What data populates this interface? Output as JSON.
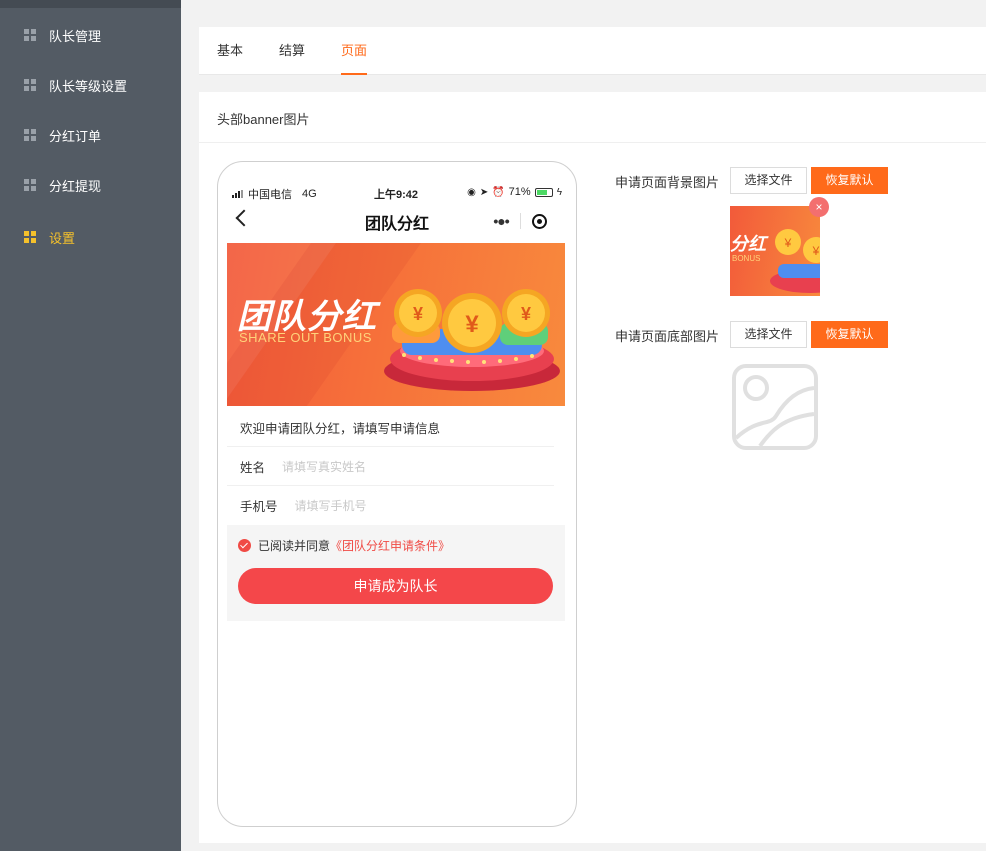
{
  "sidebar": {
    "items": [
      {
        "label": "队长管理",
        "active": false
      },
      {
        "label": "队长等级设置",
        "active": false
      },
      {
        "label": "分红订单",
        "active": false
      },
      {
        "label": "分红提现",
        "active": false
      },
      {
        "label": "设置",
        "active": true
      }
    ]
  },
  "tabs": [
    {
      "label": "基本",
      "active": false
    },
    {
      "label": "结算",
      "active": false
    },
    {
      "label": "页面",
      "active": true
    }
  ],
  "section": {
    "title": "头部banner图片"
  },
  "phone": {
    "status": {
      "carrier": "中国电信",
      "network": "4G",
      "time": "上午9:42",
      "battery": "71%",
      "battery_level": 0.71
    },
    "nav_title": "团队分红",
    "banner": {
      "title": "团队分红",
      "subtitle": "SHARE OUT BONUS",
      "coin_symbol": "¥"
    },
    "form": {
      "welcome": "欢迎申请团队分红，请填写申请信息",
      "name_label": "姓名",
      "name_placeholder": "请填写真实姓名",
      "phone_label": "手机号",
      "phone_placeholder": "请填写手机号",
      "agree_text": "已阅读并同意",
      "agree_link": "《团队分红申请条件》",
      "submit": "申请成为队长"
    }
  },
  "settings": {
    "bg_label": "申请页面背景图片",
    "bottom_label": "申请页面底部图片",
    "choose_file": "选择文件",
    "restore_default": "恢复默认",
    "remove_symbol": "×",
    "thumb_text": "分红",
    "thumb_sub": "BONUS"
  },
  "colors": {
    "accent": "#ff6a1a",
    "sidebar_bg": "#535b64",
    "sidebar_active": "#f5c12b",
    "submit_red": "#f4474a"
  }
}
